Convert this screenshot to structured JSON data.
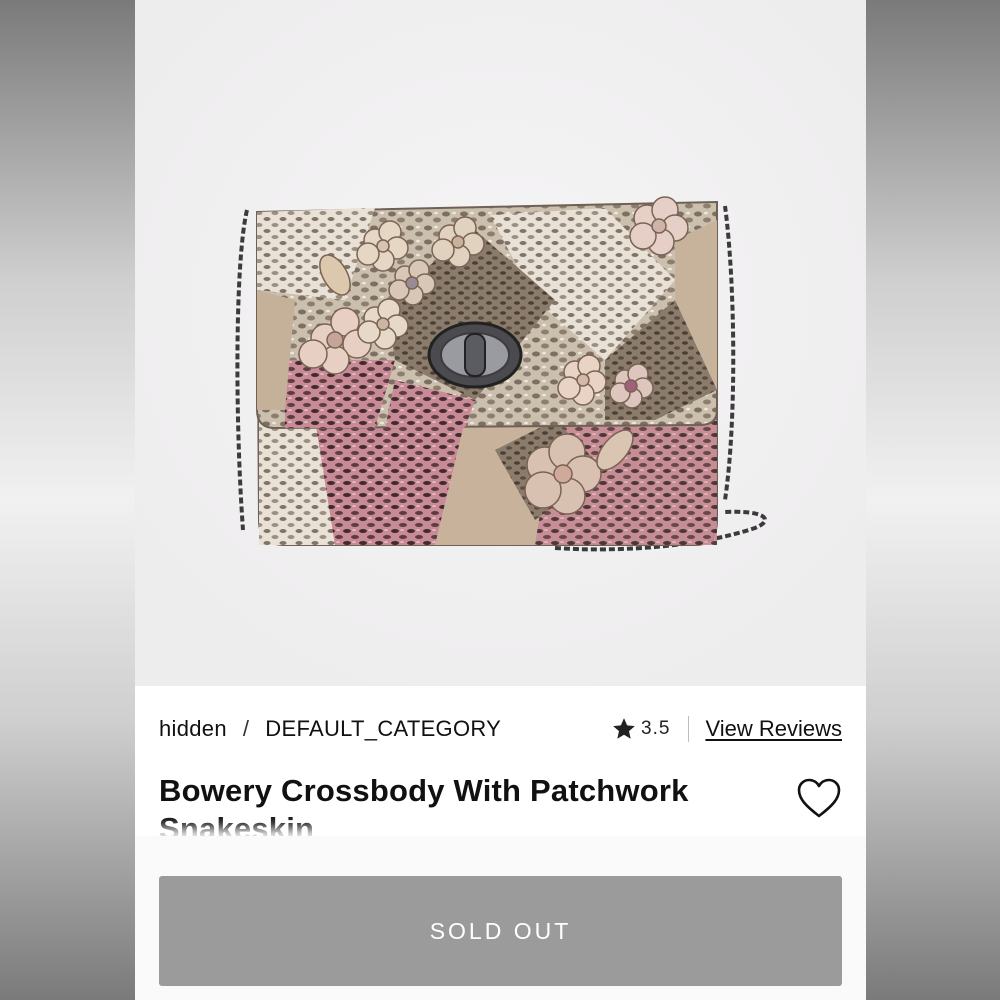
{
  "breadcrumb": {
    "brand": "hidden",
    "separator": "/",
    "category": "DEFAULT_CATEGORY"
  },
  "rating": {
    "value": "3.5",
    "icon": "star-icon",
    "reviews_link": "View Reviews"
  },
  "product": {
    "title": "Bowery Crossbody With Patchwork Snakeskin",
    "wishlist_icon": "heart-outline-icon"
  },
  "actions": {
    "sold_out_label": "SOLD OUT"
  },
  "colors": {
    "button_disabled": "#9b9b9b",
    "image_background": "#f1f0f1",
    "text": "#111111"
  }
}
